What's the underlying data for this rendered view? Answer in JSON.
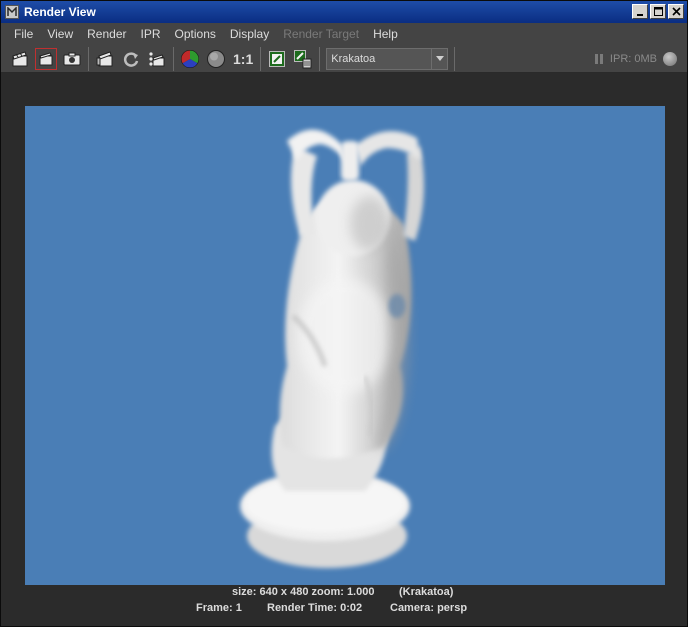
{
  "window": {
    "title": "Render View"
  },
  "menubar": {
    "items": [
      "File",
      "View",
      "Render",
      "IPR",
      "Options",
      "Display",
      "Render Target",
      "Help"
    ],
    "disabled_items": [
      "Render Target"
    ]
  },
  "toolbar": {
    "icons": [
      "render-clapper-icon",
      "render-region-icon",
      "snapshot-camera-icon",
      "ipr-render-icon",
      "refresh-icon",
      "render-sequence-icon",
      "rgb-channels-icon",
      "alpha-channel-icon",
      "keep-image-icon",
      "remove-image-icon"
    ],
    "ratio_label": "1:1",
    "renderer_dropdown": {
      "value": "Krakatoa"
    },
    "ipr_status": "IPR: 0MB"
  },
  "status": {
    "size": "size: 640 x 480 zoom: 1.000",
    "renderer": "(Krakatoa)",
    "frame": "Frame: 1",
    "render_time": "Render Time: 0:02",
    "camera": "Camera: persp"
  },
  "colors": {
    "background": "#2b2b2b",
    "render_background": "#4a7eb6",
    "title_bar": "#0a2d82"
  }
}
